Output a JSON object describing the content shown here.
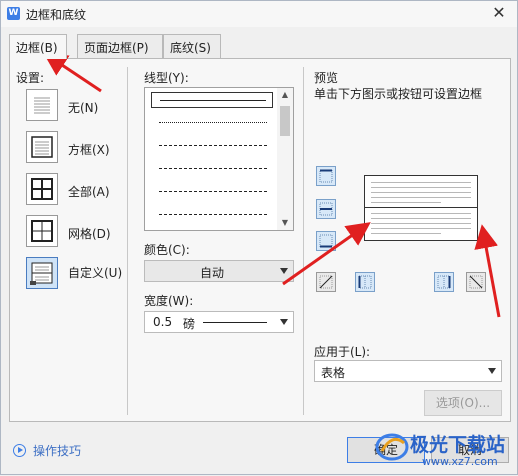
{
  "window": {
    "title": "边框和底纹",
    "app_icon": "W"
  },
  "tabs": [
    {
      "label": "边框(B)"
    },
    {
      "label": "页面边框(P)"
    },
    {
      "label": "底纹(S)"
    }
  ],
  "settings": {
    "heading": "设置:",
    "items": [
      {
        "label": "无(N)"
      },
      {
        "label": "方框(X)"
      },
      {
        "label": "全部(A)"
      },
      {
        "label": "网格(D)"
      },
      {
        "label": "自定义(U)"
      }
    ]
  },
  "line_style": {
    "heading": "线型(Y):"
  },
  "color": {
    "heading": "颜色(C):",
    "value": "自动"
  },
  "width": {
    "heading": "宽度(W):",
    "value": "0.5",
    "unit": "磅"
  },
  "preview": {
    "heading": "预览",
    "hint": "单击下方图示或按钮可设置边框",
    "apply_heading": "应用于(L):",
    "apply_value": "表格",
    "options_label": "选项(O)..."
  },
  "footer": {
    "tips_label": "操作技巧",
    "ok_label": "确定",
    "cancel_label": "取消"
  },
  "watermark": {
    "text": "极光下载站",
    "url": "www.xz7.com"
  },
  "colors": {
    "accent": "#3d7ee6",
    "arrow": "#e02020"
  }
}
